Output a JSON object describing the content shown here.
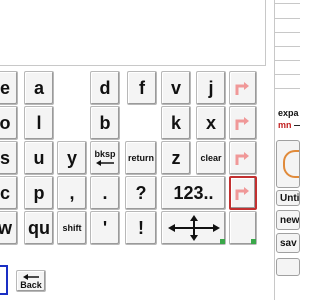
{
  "rows": [
    [
      "e",
      "a",
      "d",
      "f",
      "v",
      "j"
    ],
    [
      "o",
      "l",
      "b",
      "k",
      "x"
    ],
    [
      "s",
      "u",
      "y"
    ],
    [
      "c",
      "p",
      ",",
      ".",
      "?",
      "123.."
    ],
    [
      "w",
      "qu",
      "shift",
      "'",
      "!"
    ]
  ],
  "special": {
    "bksp": "bksp",
    "return": "return",
    "clear": "clear",
    "z": "z",
    "shift": "shift"
  },
  "right_panel": {
    "expand_label": "expa",
    "mn_label": "mn",
    "untitled_label": "Untitle",
    "new_label": "new",
    "save_label": "sav"
  },
  "footer": {
    "back_label": "Back"
  }
}
